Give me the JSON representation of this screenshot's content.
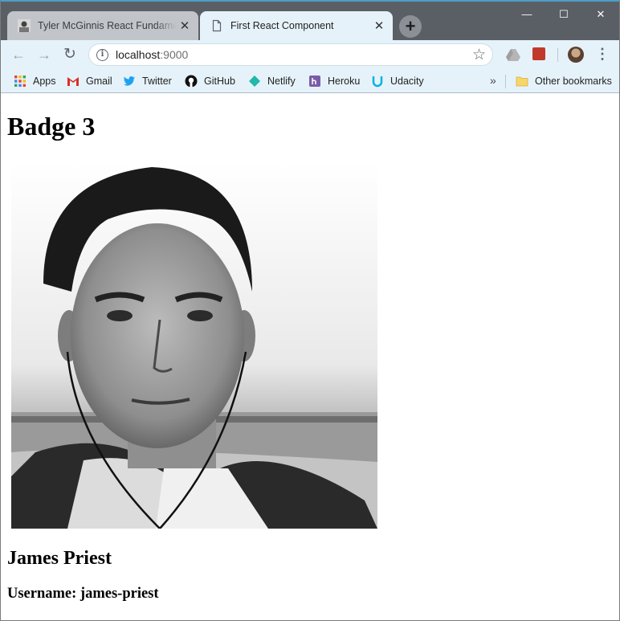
{
  "browser": {
    "tabs": [
      {
        "title": "Tyler McGinnis React Fundamentals",
        "active": false,
        "close": "✕"
      },
      {
        "title": "First React Component",
        "active": true,
        "close": "✕"
      }
    ],
    "new_tab": "+",
    "window_controls": {
      "minimize": "—",
      "maximize": "☐",
      "close": "✕"
    },
    "nav": {
      "back": "←",
      "forward": "→",
      "reload": "↻"
    },
    "address": {
      "host": "localhost",
      "port": ":9000"
    },
    "icons": {
      "info": "i",
      "star": "☆",
      "menu": "⋮"
    },
    "bookmarks": [
      {
        "label": "Apps",
        "icon": "apps-grid-icon"
      },
      {
        "label": "Gmail",
        "icon": "gmail-icon"
      },
      {
        "label": "Twitter",
        "icon": "twitter-icon"
      },
      {
        "label": "GitHub",
        "icon": "github-icon"
      },
      {
        "label": "Netlify",
        "icon": "netlify-icon"
      },
      {
        "label": "Heroku",
        "icon": "heroku-icon"
      },
      {
        "label": "Udacity",
        "icon": "udacity-icon"
      }
    ],
    "bookmarks_overflow": "»",
    "other_bookmarks": "Other bookmarks"
  },
  "page": {
    "heading": "Badge 3",
    "name": "James Priest",
    "username": "Username: james-priest"
  },
  "colors": {
    "tabstrip": "#5a5f66",
    "toolbar": "#e6f2fa",
    "accent": "#4a9ec7"
  }
}
